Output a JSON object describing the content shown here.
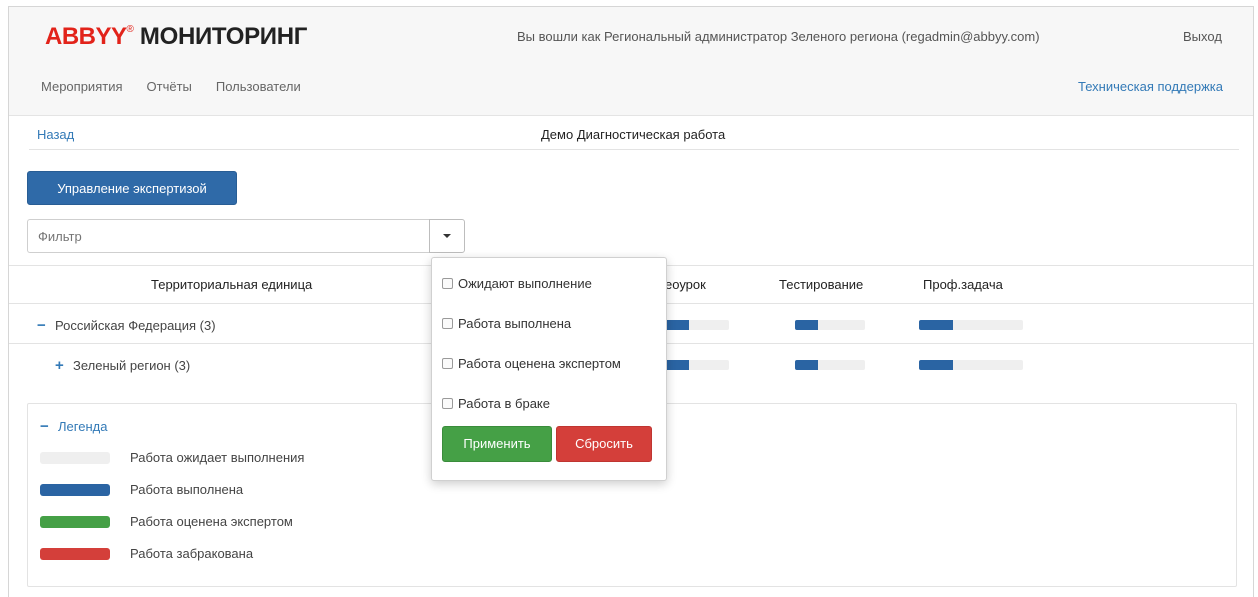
{
  "header": {
    "logo_brand": "ABBYY",
    "logo_registered": "®",
    "logo_product": "МОНИТОРИНГ",
    "user_info": "Вы вошли как Региональный администратор Зеленого региона (regadmin@abbyy.com)",
    "logout_label": "Выход",
    "nav": [
      "Мероприятия",
      "Отчёты",
      "Пользователи"
    ],
    "support_label": "Техническая поддержка"
  },
  "toolbar": {
    "back_label": "Назад",
    "page_title": "Демо Диагностическая работа",
    "manage_button_label": "Управление экспертизой",
    "filter_placeholder": "Фильтр"
  },
  "table": {
    "columns": [
      "Территориальная единица",
      "еоурок",
      "Тестирование",
      "Проф.задача"
    ],
    "rows": [
      {
        "sign": "−",
        "label": "Российская Федерация (3)",
        "progress": [
          0.38,
          0.33,
          0.33
        ]
      },
      {
        "sign": "+",
        "label": "Зеленый регион (3)",
        "progress": [
          0.38,
          0.33,
          0.33
        ]
      }
    ]
  },
  "legend": {
    "sign": "−",
    "title": "Легенда",
    "items": [
      {
        "label": "Работа ожидает выполнения",
        "color": "#efefef"
      },
      {
        "label": "Работа выполнена",
        "color": "#2a64a3"
      },
      {
        "label": "Работа оценена экспертом",
        "color": "#45a046"
      },
      {
        "label": "Работа забракована",
        "color": "#d43f3a"
      }
    ]
  },
  "filter_dropdown": {
    "options": [
      {
        "label": "Ожидают выполнение",
        "checked": false
      },
      {
        "label": "Работа выполнена",
        "checked": false
      },
      {
        "label": "Работа оценена экспертом",
        "checked": false
      },
      {
        "label": "Работа в браке",
        "checked": false
      }
    ],
    "apply_label": "Применить",
    "reset_label": "Сбросить"
  },
  "colors": {
    "primary": "#2f6aa8",
    "link": "#337ab7",
    "brand_red": "#e2231a",
    "progress_done": "#2a64a3",
    "success": "#45a046",
    "danger": "#d43f3a"
  }
}
